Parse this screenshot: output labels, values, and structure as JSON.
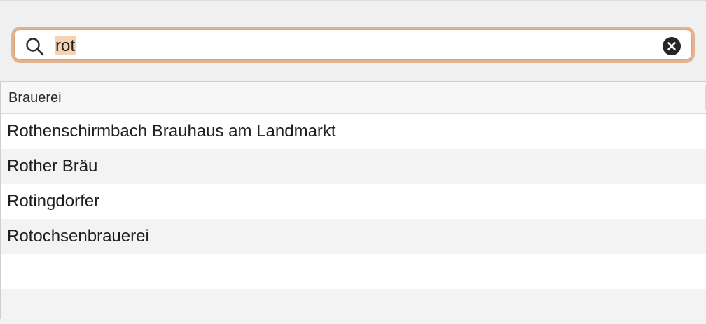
{
  "search": {
    "value": "rot"
  },
  "table": {
    "column_header": "Brauerei",
    "rows": [
      {
        "label": "Rothenschirmbach Brauhaus am Landmarkt"
      },
      {
        "label": "Rother Bräu"
      },
      {
        "label": "Rotingdorfer"
      },
      {
        "label": "Rotochsenbrauerei"
      },
      {
        "label": ""
      },
      {
        "label": ""
      }
    ]
  },
  "colors": {
    "focus_ring": "#e3b28e",
    "selection_highlight": "#f6d2b4",
    "row_alt": "#f3f3f3"
  },
  "icons": {
    "search": "magnifying-glass",
    "clear": "x-circle-filled"
  }
}
